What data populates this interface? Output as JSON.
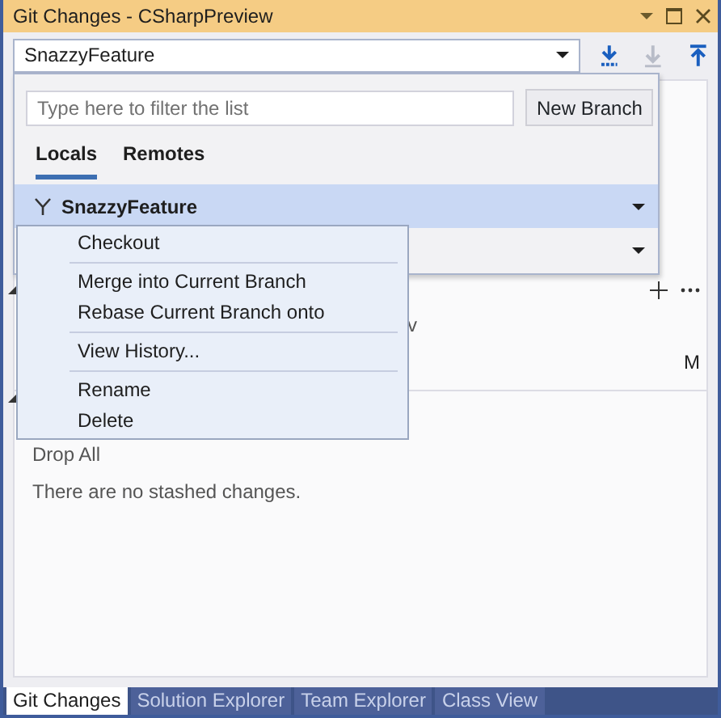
{
  "window": {
    "title": "Git Changes - CSharpPreview"
  },
  "branch_selector": {
    "value": "SnazzyFeature",
    "expanded": true
  },
  "toolbar": [
    {
      "kind": "fetch",
      "disabled": false
    },
    {
      "kind": "pull",
      "disabled": true
    },
    {
      "kind": "push",
      "disabled": false
    }
  ],
  "branch_popup": {
    "filter": {
      "placeholder": "Type here to filter the list"
    },
    "new_branch_button": "New Branch",
    "tabs": [
      {
        "label": "Locals",
        "selected": true
      },
      {
        "label": "Remotes",
        "selected": false
      }
    ],
    "branches": [
      {
        "name": "SnazzyFeature",
        "selected": true
      },
      {
        "selected": false
      }
    ]
  },
  "context_menu": {
    "groups": [
      [
        "Checkout"
      ],
      [
        "Merge into Current Branch",
        "Rebase Current Branch onto"
      ],
      [
        "View History..."
      ],
      [
        "Rename",
        "Delete"
      ]
    ]
  },
  "background": {
    "changes_fragment": "v",
    "status": "M",
    "stash_action": "Drop All",
    "stash_message": "There are no stashed changes."
  },
  "bottom_tabs": [
    {
      "label": "Git Changes",
      "selected": true
    },
    {
      "label": "Solution Explorer",
      "selected": false
    },
    {
      "label": "Team Explorer",
      "selected": false
    },
    {
      "label": "Class View",
      "selected": false
    }
  ]
}
